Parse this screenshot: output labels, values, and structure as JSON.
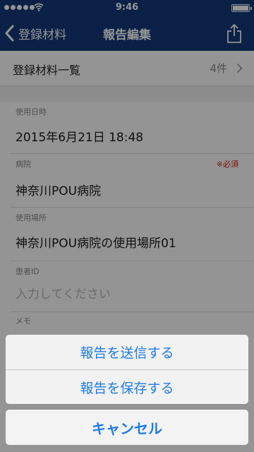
{
  "status_bar": {
    "time": "9:46",
    "signal_dots": 5
  },
  "nav": {
    "back_label": "登録材料",
    "title": "報告編集",
    "share_icon": "share-icon"
  },
  "materials": {
    "title": "登録材料一覧",
    "count": "4件"
  },
  "fields": [
    {
      "label": "使用日時",
      "value": "2015年6月21日 18:48",
      "required": ""
    },
    {
      "label": "病院",
      "value": "神奈川POU病院",
      "required": "※必須"
    },
    {
      "label": "使用場所",
      "value": "神奈川POU病院の使用場所01",
      "required": ""
    },
    {
      "label": "患者ID",
      "placeholder": "入力してください",
      "required": ""
    },
    {
      "label": "メモ"
    }
  ],
  "action_sheet": {
    "send_label": "報告を送信する",
    "save_label": "報告を保存する",
    "cancel_label": "キャンセル"
  },
  "colors": {
    "nav_bg": "#12387a",
    "action_blue": "#1e7bea",
    "required_red": "#d0221b"
  }
}
